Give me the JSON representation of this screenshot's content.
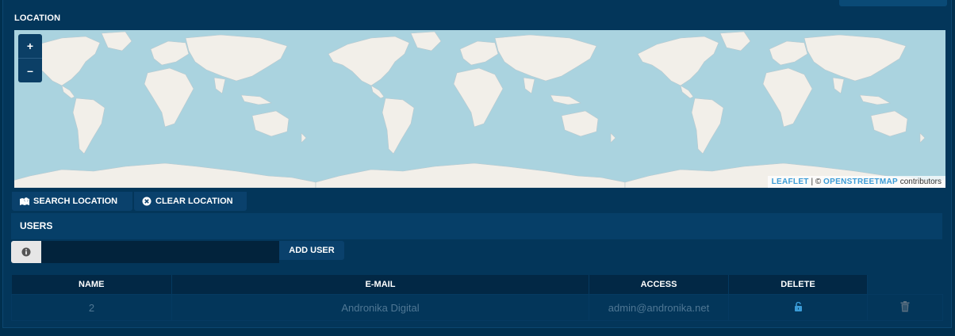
{
  "location": {
    "label": "LOCATION",
    "zoom_in_label": "+",
    "zoom_out_label": "–",
    "attribution": {
      "leaflet": "LEAFLET",
      "separator": " | © ",
      "osm": "OPENSTREETMAP",
      "suffix": " contributors"
    }
  },
  "actions": {
    "search_label": "SEARCH LOCATION",
    "clear_label": "CLEAR LOCATION"
  },
  "users": {
    "title": "USERS",
    "input_value": "",
    "add_label": "ADD USER",
    "columns": [
      "NAME",
      "E-MAIL",
      "ACCESS",
      "DELETE"
    ],
    "rows": [
      {
        "name": "2",
        "email": "Andronika Digital",
        "access": "admin@andronika.net"
      }
    ]
  },
  "colors": {
    "background": "#01304f",
    "panel": "#03365a",
    "ocean": "#aad3df",
    "land": "#f2efe9",
    "link": "#3a9bd6"
  }
}
